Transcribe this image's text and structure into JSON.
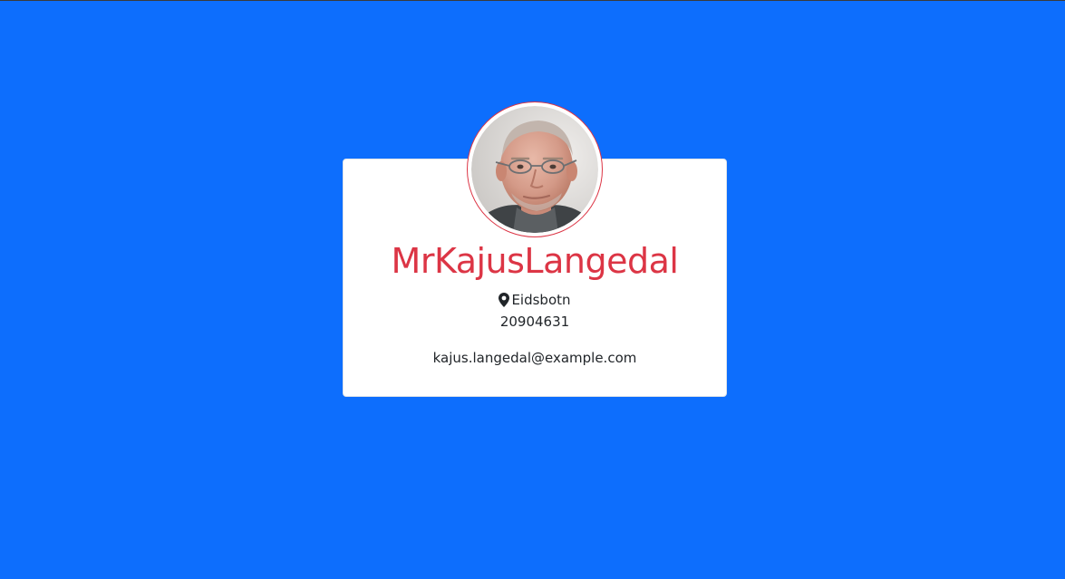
{
  "profile": {
    "name": "MrKajusLangedal",
    "location": "Eidsbotn",
    "phone": "20904631",
    "email": "kajus.langedal@example.com",
    "avatar_icon": "profile-photo"
  },
  "colors": {
    "background": "#0d6efd",
    "name": "#dc3545",
    "card": "#ffffff",
    "text": "#212529"
  }
}
